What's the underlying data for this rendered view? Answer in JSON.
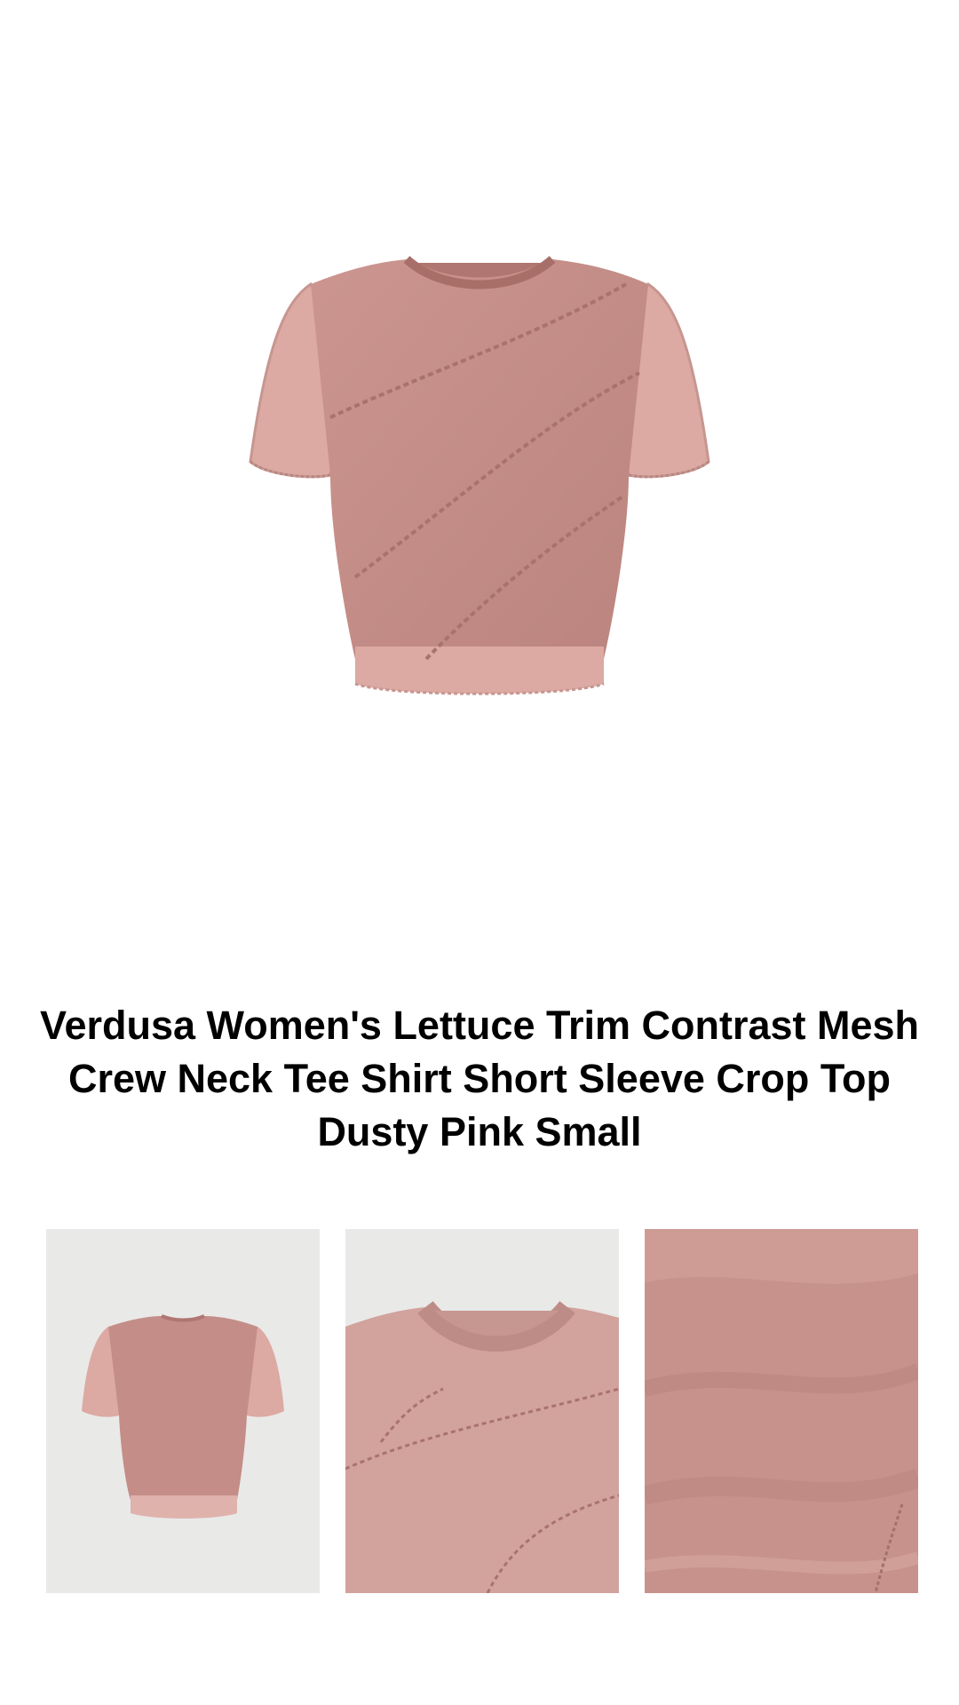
{
  "product": {
    "title": "Verdusa Women's Lettuce Trim Contrast Mesh Crew Neck Tee Shirt Short Sleeve Crop Top Dusty Pink Small"
  },
  "images": {
    "main": "shirt-front-photo",
    "thumbnails": [
      "shirt-back-photo",
      "shirt-neckline-detail-photo",
      "mesh-fabric-texture-photo"
    ]
  },
  "colors": {
    "shirt_main": "#c9918c",
    "shirt_sheer": "#dca9a3",
    "shirt_dark": "#b27b75",
    "thumb_bg": "#e9e9e8",
    "title_text": "#000000"
  }
}
